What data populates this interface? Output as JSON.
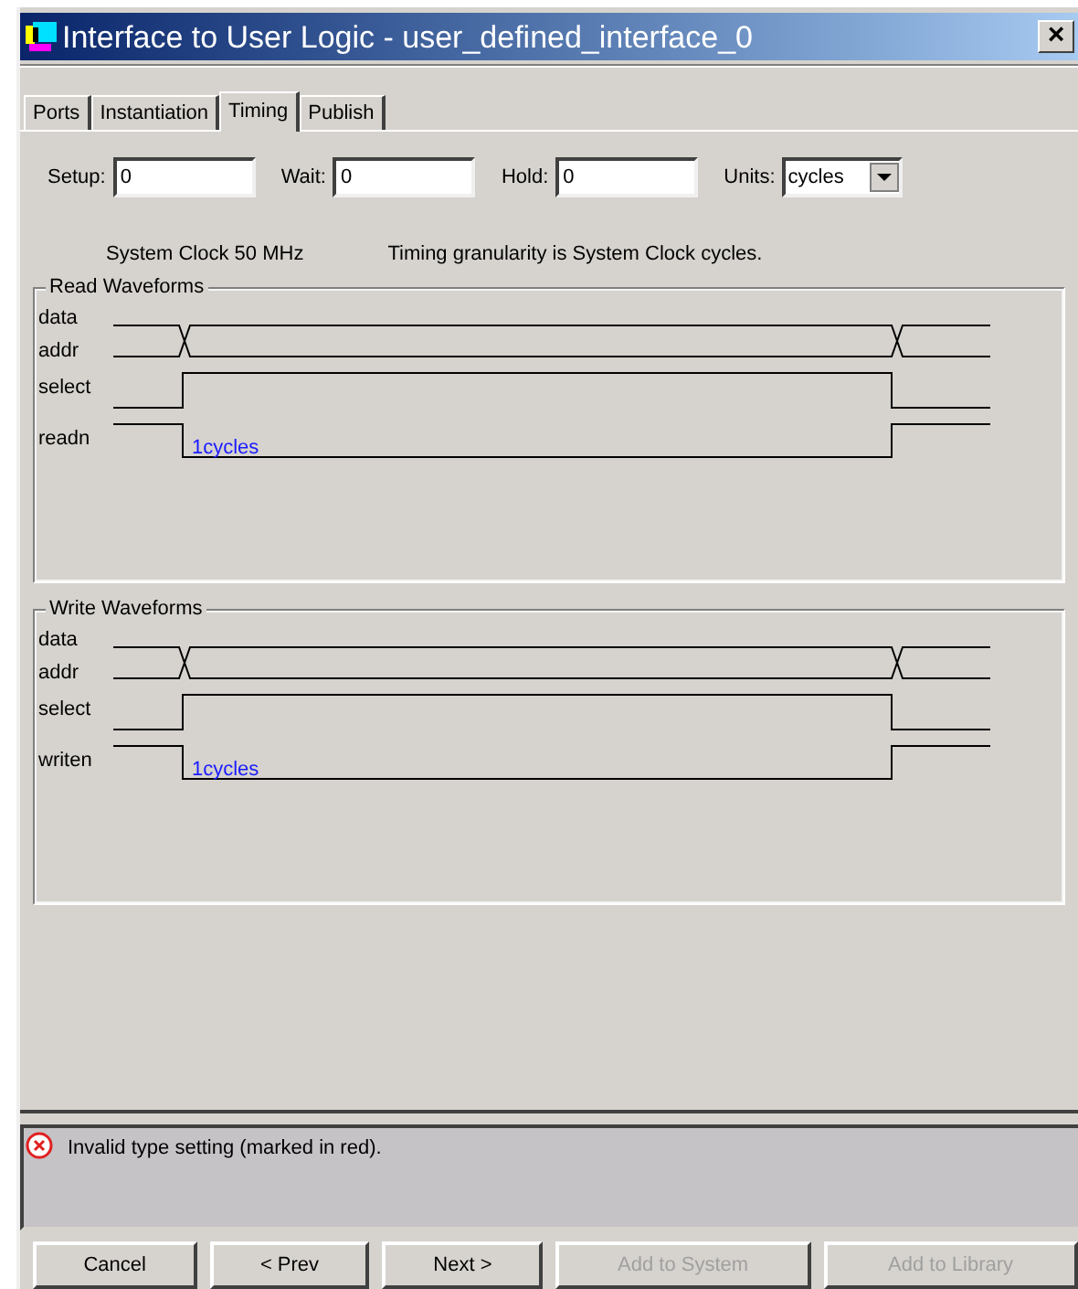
{
  "window": {
    "title": "Interface to User Logic - user_defined_interface_0",
    "close": "×"
  },
  "tabs": [
    {
      "label": "Ports",
      "selected": false
    },
    {
      "label": "Instantiation",
      "selected": false
    },
    {
      "label": "Timing",
      "selected": true
    },
    {
      "label": "Publish",
      "selected": false
    }
  ],
  "fields": [
    {
      "label": "Setup:",
      "value": "0"
    },
    {
      "label": "Wait:",
      "value": "0"
    },
    {
      "label": "Hold:",
      "value": "0"
    }
  ],
  "units": {
    "label": "Units:",
    "value": "cycles"
  },
  "info": [
    "System Clock 50 MHz",
    "Timing granularity is System Clock cycles."
  ],
  "panels": [
    {
      "title": "Read Waveforms",
      "signals": [
        "data",
        "addr",
        "select",
        "readn"
      ],
      "duration": "1cycles"
    },
    {
      "title": "Write Waveforms",
      "signals": [
        "data",
        "addr",
        "select",
        "writen"
      ],
      "duration": "1cycles"
    }
  ],
  "message": {
    "kind": "error",
    "text": "Invalid type setting (marked in red)."
  },
  "buttons": [
    {
      "label": "Cancel",
      "disabled": false
    },
    {
      "label": "< Prev",
      "disabled": false
    },
    {
      "label": "Next >",
      "disabled": false
    },
    {
      "label": "Add to System",
      "disabled": true
    },
    {
      "label": "Add to Library",
      "disabled": true
    }
  ]
}
